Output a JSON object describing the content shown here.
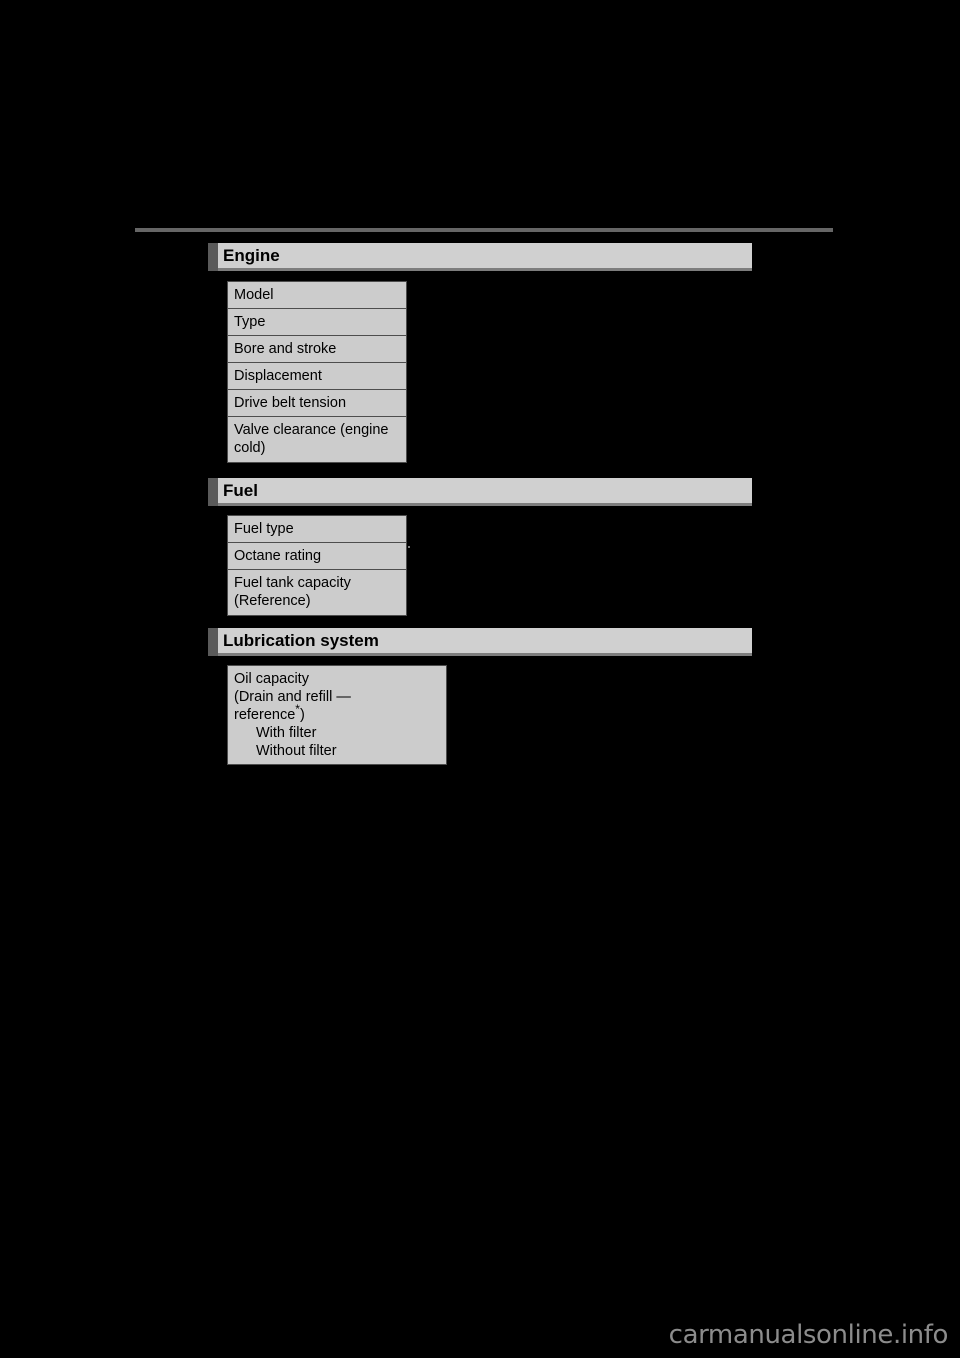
{
  "page": {
    "background_color": "#000000",
    "rule_color": "#666666"
  },
  "watermark": {
    "text": "carmanualsonline.info"
  },
  "sections": [
    {
      "id": "engine",
      "title": "Engine",
      "rows": [
        {
          "label": "Model"
        },
        {
          "label": "Type"
        },
        {
          "label": "Bore and stroke"
        },
        {
          "label": "Displacement"
        },
        {
          "label": "Drive belt tension"
        },
        {
          "label": "Valve clearance (engine cold)"
        }
      ]
    },
    {
      "id": "fuel",
      "title": "Fuel",
      "rows": [
        {
          "label": "Fuel type"
        },
        {
          "label": "Octane rating"
        },
        {
          "label": "Fuel tank capacity (Reference)"
        }
      ]
    },
    {
      "id": "lubrication-system",
      "title": "Lubrication system",
      "rows": [
        {
          "label": "Oil capacity",
          "line2": "(Drain and refill —",
          "line3_pre": "reference",
          "line3_star": "*",
          "line3_post": ")",
          "sub_items": [
            "With filter",
            "Without filter"
          ]
        }
      ]
    }
  ],
  "colors": {
    "header_bar": "#d0d0d0",
    "header_accent": "#5a5a5a",
    "header_shadow": "#7d7d7d",
    "cell_fill": "#cccccc",
    "cell_border": "#4d4d4d",
    "text": "#000000",
    "watermark": "#8c8c8c"
  }
}
